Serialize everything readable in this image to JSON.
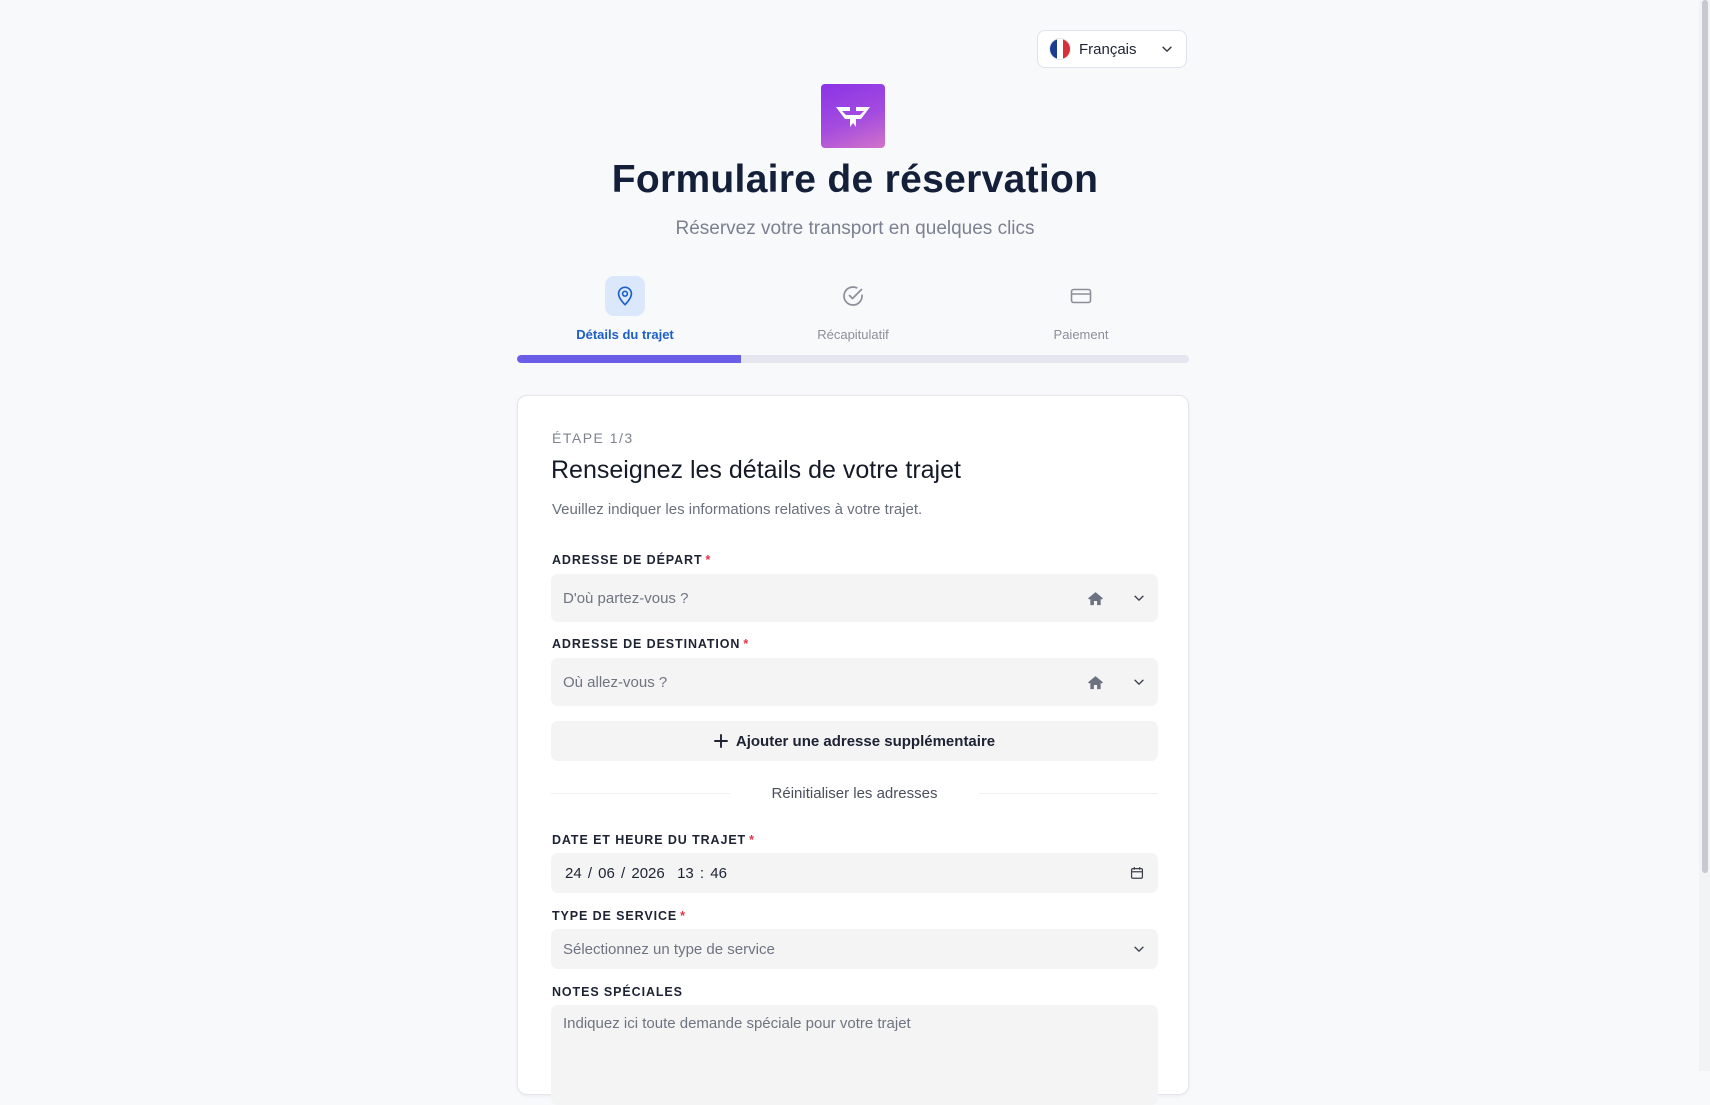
{
  "language": {
    "label": "Français",
    "flag_colors": [
      "#1a3d8f",
      "#ffffff",
      "#d92f3a"
    ]
  },
  "header": {
    "title": "Formulaire de réservation",
    "subtitle": "Réservez votre transport en quelques clics"
  },
  "steps": [
    {
      "label": "Détails du trajet",
      "icon": "map-pin-icon",
      "active": true
    },
    {
      "label": "Récapitulatif",
      "icon": "check-circle-icon",
      "active": false
    },
    {
      "label": "Paiement",
      "icon": "credit-card-icon",
      "active": false
    }
  ],
  "progress": {
    "completed_fraction": 0.333
  },
  "form": {
    "step_counter": "ÉTAPE 1/3",
    "title": "Renseignez les détails de votre trajet",
    "description": "Veuillez indiquer les informations relatives à votre trajet.",
    "departure": {
      "label": "ADRESSE DE DÉPART",
      "required_mark": "*",
      "placeholder": "D'où partez-vous ?"
    },
    "destination": {
      "label": "ADRESSE DE DESTINATION",
      "required_mark": "*",
      "placeholder": "Où allez-vous ?"
    },
    "add_address_label": "Ajouter une adresse supplémentaire",
    "reset_label": "Réinitialiser les adresses",
    "datetime": {
      "label": "DATE ET HEURE DU TRAJET",
      "required_mark": "*",
      "value": "24 / 06 / 2026  13 : 46"
    },
    "service_type": {
      "label": "TYPE DE SERVICE",
      "required_mark": "*",
      "placeholder": "Sélectionnez un type de service"
    },
    "notes": {
      "label": "NOTES SPÉCIALES",
      "placeholder": "Indiquez ici toute demande spéciale pour votre trajet"
    }
  },
  "colors": {
    "accent": "#6a5ee8",
    "active_step": "#1d5fc8",
    "required": "#e0344a",
    "logo_from": "#8a34e6",
    "logo_to": "#d173c9"
  }
}
